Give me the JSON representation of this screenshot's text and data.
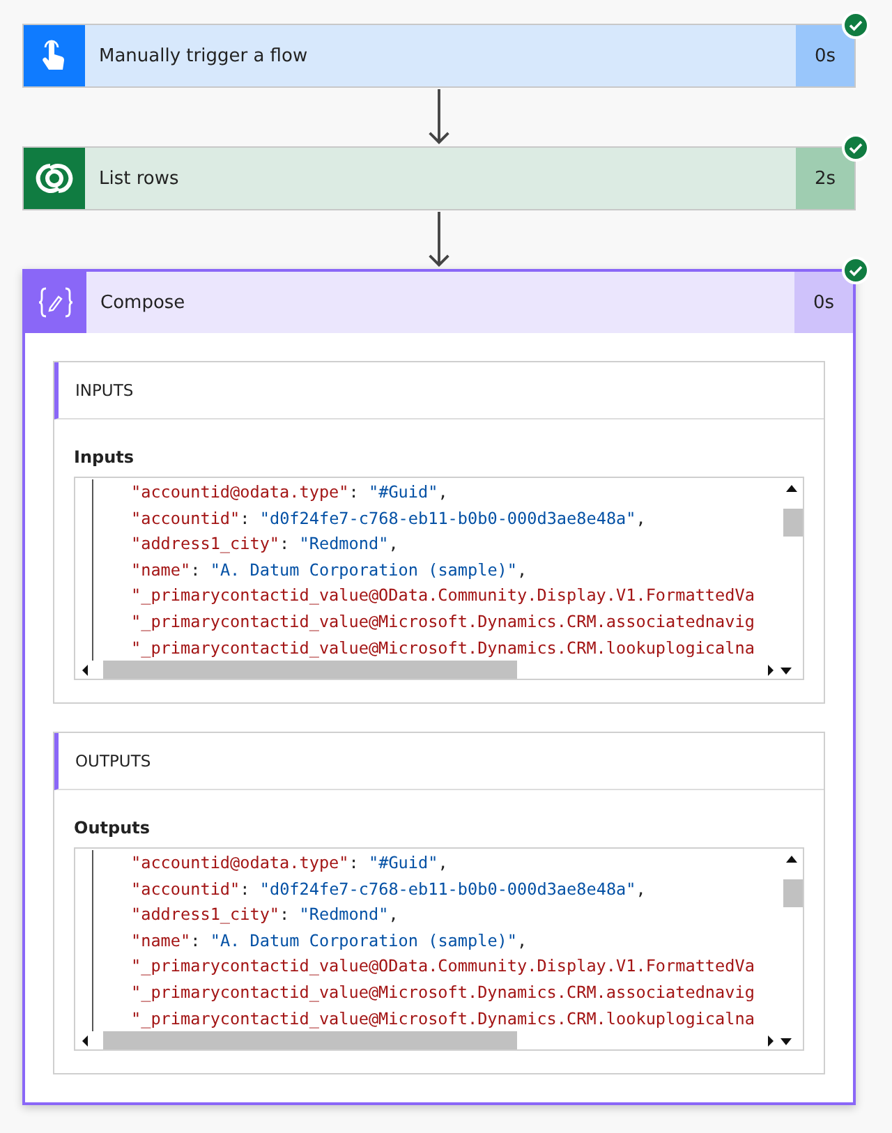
{
  "steps": [
    {
      "kind": "trigger",
      "title": "Manually trigger a flow",
      "duration": "0s",
      "succeeded": true,
      "selected": false,
      "expanded": false
    },
    {
      "kind": "dataverse",
      "title": "List rows",
      "duration": "2s",
      "succeeded": true,
      "selected": false,
      "expanded": false
    },
    {
      "kind": "compose",
      "title": "Compose",
      "duration": "0s",
      "succeeded": true,
      "selected": true,
      "expanded": true,
      "sections": [
        {
          "heading": "INPUTS",
          "label": "Inputs",
          "lines": [
            {
              "key": "\"accountid@odata.type\"",
              "sep": ": ",
              "value": "\"#Guid\"",
              "end": ","
            },
            {
              "key": "\"accountid\"",
              "sep": ": ",
              "value": "\"d0f24fe7-c768-eb11-b0b0-000d3ae8e48a\"",
              "end": ","
            },
            {
              "key": "\"address1_city\"",
              "sep": ": ",
              "value": "\"Redmond\"",
              "end": ","
            },
            {
              "key": "\"name\"",
              "sep": ": ",
              "value": "\"A. Datum Corporation (sample)\"",
              "end": ","
            },
            {
              "key": "\"_primarycontactid_value@OData.Community.Display.V1.FormattedVa"
            },
            {
              "key": "\"_primarycontactid_value@Microsoft.Dynamics.CRM.associatednavig"
            },
            {
              "key": "\"_primarycontactid_value@Microsoft.Dynamics.CRM.lookuplogicalna"
            }
          ]
        },
        {
          "heading": "OUTPUTS",
          "label": "Outputs",
          "lines": [
            {
              "key": "\"accountid@odata.type\"",
              "sep": ": ",
              "value": "\"#Guid\"",
              "end": ","
            },
            {
              "key": "\"accountid\"",
              "sep": ": ",
              "value": "\"d0f24fe7-c768-eb11-b0b0-000d3ae8e48a\"",
              "end": ","
            },
            {
              "key": "\"address1_city\"",
              "sep": ": ",
              "value": "\"Redmond\"",
              "end": ","
            },
            {
              "key": "\"name\"",
              "sep": ": ",
              "value": "\"A. Datum Corporation (sample)\"",
              "end": ","
            },
            {
              "key": "\"_primarycontactid_value@OData.Community.Display.V1.FormattedVa"
            },
            {
              "key": "\"_primarycontactid_value@Microsoft.Dynamics.CRM.associatednavig"
            },
            {
              "key": "\"_primarycontactid_value@Microsoft.Dynamics.CRM.lookuplogicalna"
            }
          ]
        }
      ]
    }
  ]
}
